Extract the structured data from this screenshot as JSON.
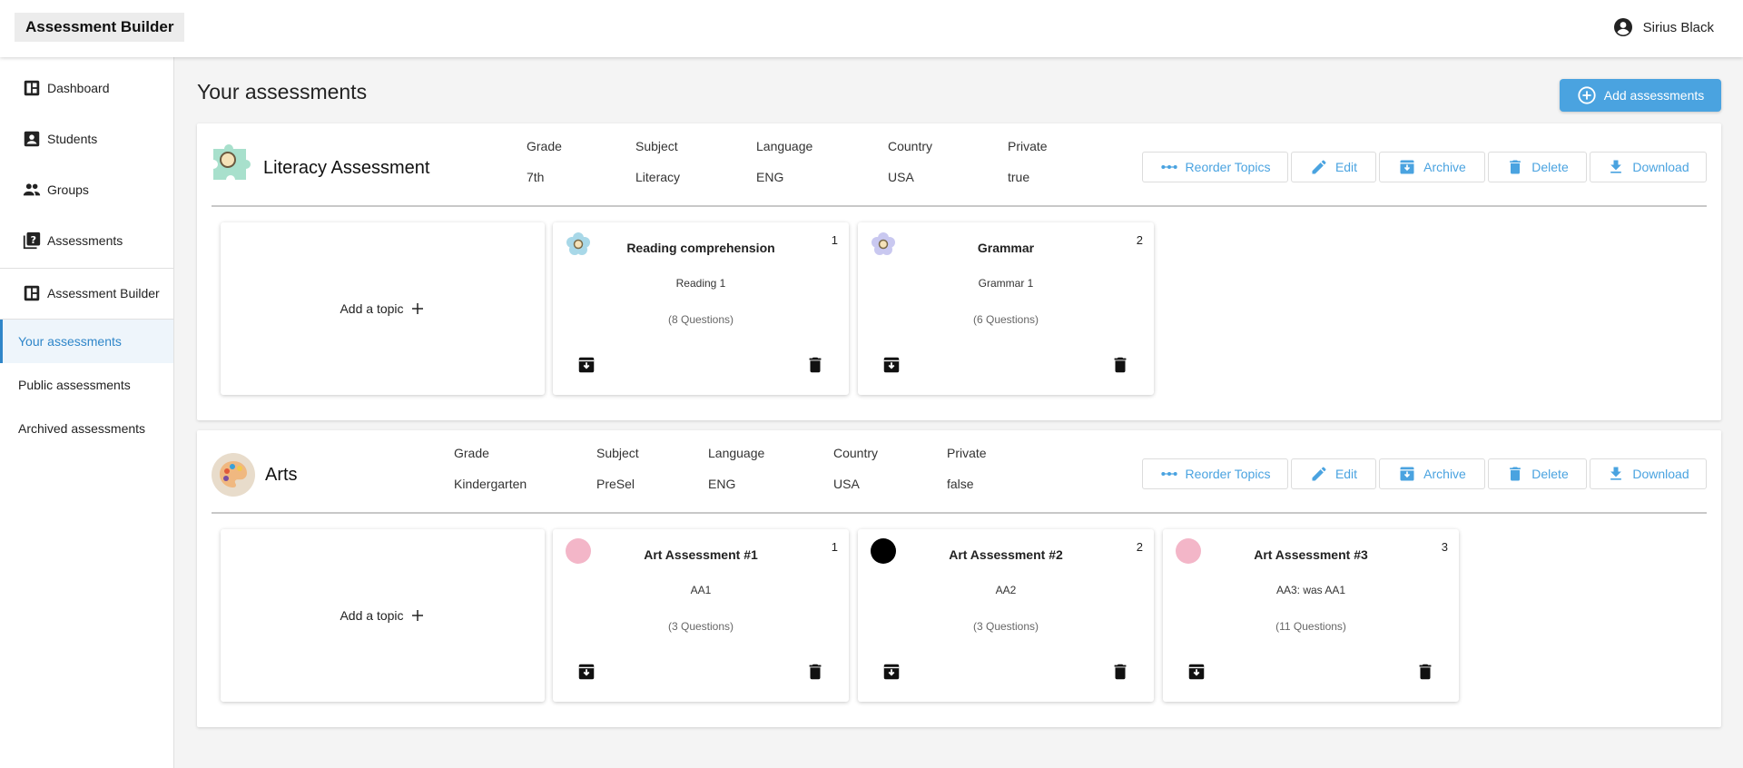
{
  "app": {
    "title": "Assessment Builder",
    "user_name": "Sirius Black"
  },
  "sidebar": {
    "items": [
      {
        "label": "Dashboard"
      },
      {
        "label": "Students"
      },
      {
        "label": "Groups"
      },
      {
        "label": "Assessments"
      },
      {
        "label": "Assessment Builder"
      }
    ],
    "sub_items": [
      {
        "label": "Your assessments",
        "active": true
      },
      {
        "label": "Public assessments"
      },
      {
        "label": "Archived assessments"
      }
    ]
  },
  "main": {
    "title": "Your assessments",
    "add_button": "Add assessments",
    "actions": {
      "reorder": "Reorder Topics",
      "edit": "Edit",
      "archive": "Archive",
      "delete": "Delete",
      "download": "Download"
    },
    "add_topic_label": "Add a topic",
    "meta_labels": {
      "grade": "Grade",
      "subject": "Subject",
      "language": "Language",
      "country": "Country",
      "private": "Private"
    },
    "assessments": [
      {
        "name": "Literacy Assessment",
        "grade": "7th",
        "subject": "Literacy",
        "language": "ENG",
        "country": "USA",
        "private": "true",
        "topics": [
          {
            "number": "1",
            "title": "Reading comprehension",
            "subtitle": "Reading 1",
            "questions": "(8 Questions)",
            "badge_color": "#a8d8e8"
          },
          {
            "number": "2",
            "title": "Grammar",
            "subtitle": "Grammar 1",
            "questions": "(6 Questions)",
            "badge_color": "#c9c8f0"
          }
        ]
      },
      {
        "name": "Arts",
        "grade": "Kindergarten",
        "subject": "PreSel",
        "language": "ENG",
        "country": "USA",
        "private": "false",
        "topics": [
          {
            "number": "1",
            "title": "Art Assessment #1",
            "subtitle": "AA1",
            "questions": "(3 Questions)",
            "badge_color": "#f3b6c8"
          },
          {
            "number": "2",
            "title": "Art Assessment #2",
            "subtitle": "AA2",
            "questions": "(3 Questions)",
            "badge_color": "#000000"
          },
          {
            "number": "3",
            "title": "Art Assessment #3",
            "subtitle": "AA3: was AA1",
            "questions": "(11 Questions)",
            "badge_color": "#f3b6c8"
          }
        ]
      }
    ]
  },
  "colors": {
    "accent": "#4aa3e0",
    "active_nav": "#2f86c9"
  }
}
